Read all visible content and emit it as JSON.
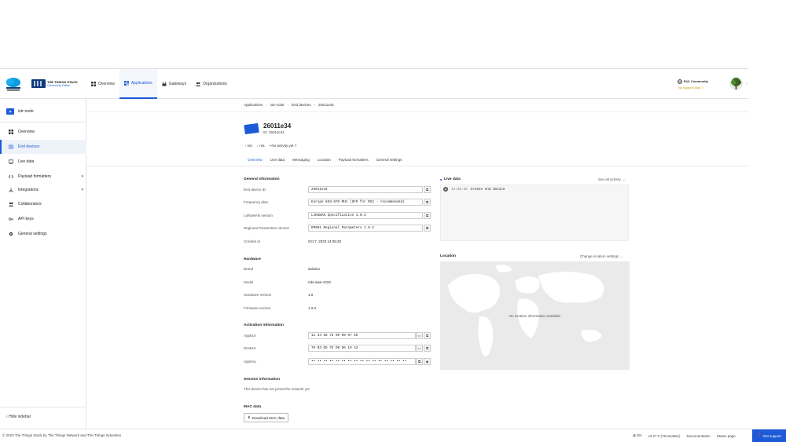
{
  "header": {
    "brand_title": "THE THINGS STACK",
    "brand_sub": "Community Edition",
    "tti_label": "THE THINGS NETWORK",
    "nav": [
      {
        "label": "Overview",
        "icon": "grid-icon"
      },
      {
        "label": "Applications",
        "icon": "apps-icon",
        "active": true
      },
      {
        "label": "Gateways",
        "icon": "gateway-icon"
      },
      {
        "label": "Organizations",
        "icon": "people-icon"
      }
    ],
    "tenant_name": "EU1 Community",
    "tenant_plan": "No support plan"
  },
  "sidebar": {
    "app_name": "iotr-node",
    "items": [
      {
        "label": "Overview",
        "icon": "overview-icon"
      },
      {
        "label": "End devices",
        "icon": "device-icon",
        "active": true
      },
      {
        "label": "Live data",
        "icon": "live-icon"
      },
      {
        "label": "Payload formatters",
        "icon": "code-icon",
        "expandable": true
      },
      {
        "label": "Integrations",
        "icon": "integrations-icon",
        "expandable": true
      },
      {
        "label": "Collaborators",
        "icon": "collaborators-icon"
      },
      {
        "label": "API keys",
        "icon": "key-icon"
      },
      {
        "label": "General settings",
        "icon": "gear-icon"
      }
    ],
    "hide_label": "Hide sidebar"
  },
  "breadcrumb": [
    "Applications",
    "iotr-node",
    "End devices",
    "26011e34"
  ],
  "device": {
    "title": "26011e34",
    "id_line": "ID: 26011e34",
    "uplink": "n/a",
    "downlink": "n/a",
    "activity": "No activity yet"
  },
  "tabs": [
    "Overview",
    "Live data",
    "Messaging",
    "Location",
    "Payload formatters",
    "General settings"
  ],
  "general": {
    "title": "General information",
    "end_device_id_label": "End device ID",
    "end_device_id": "26011e34",
    "frequency_label": "Frequency plan",
    "frequency": "Europe 863-870 MHz (SF9 for RX2 - recommended)",
    "lorawan_label": "LoRaWAN version",
    "lorawan": "LoRaWAN Specification 1.0.3",
    "regional_label": "Regional Parameters version",
    "regional": "RP001 Regional Parameters 1.0.2",
    "created_label": "Created at",
    "created": "Oct 7, 2023 14:06:20"
  },
  "hardware": {
    "title": "Hardware",
    "brand_label": "Brand",
    "brand": "arduino",
    "model_label": "Model",
    "model": "mkr-wan-1310",
    "hw_label": "Hardware version",
    "hw": "1.0",
    "fw_label": "Firmware version",
    "fw": "1.2.0"
  },
  "activation": {
    "title": "Activation information",
    "appeui_label": "AppEUI",
    "appeui": "12 34 56 78 90 09 87 65",
    "deveui_label": "DevEUI",
    "deveui": "70 B3 D5 7E D0 06 19 A2",
    "appkey_label": "AppKey",
    "appkey": "•• •• •• •• •• •• •• •• •• •• •• •• •• •• •• ••"
  },
  "session": {
    "title": "Session information",
    "text": "This device has not joined the network yet"
  },
  "mac": {
    "title": "MAC data",
    "button": "Download MAC data"
  },
  "live": {
    "title": "Live data",
    "see_all": "See all activity →",
    "time": "14:06:20",
    "event": "Create end device"
  },
  "location": {
    "title": "Location",
    "change": "Change location settings →",
    "empty": "No location information available"
  },
  "footer": {
    "copyright": "© 2023 The Things Stack by The Things Network and The Things Industries",
    "lang": "EN",
    "version": "v3.27.2 (7613ca55c)",
    "docs": "Documentation",
    "status": "Status page",
    "support": "Get support"
  },
  "colors": {
    "accent": "#1d5ad8",
    "warning": "#c69100"
  }
}
